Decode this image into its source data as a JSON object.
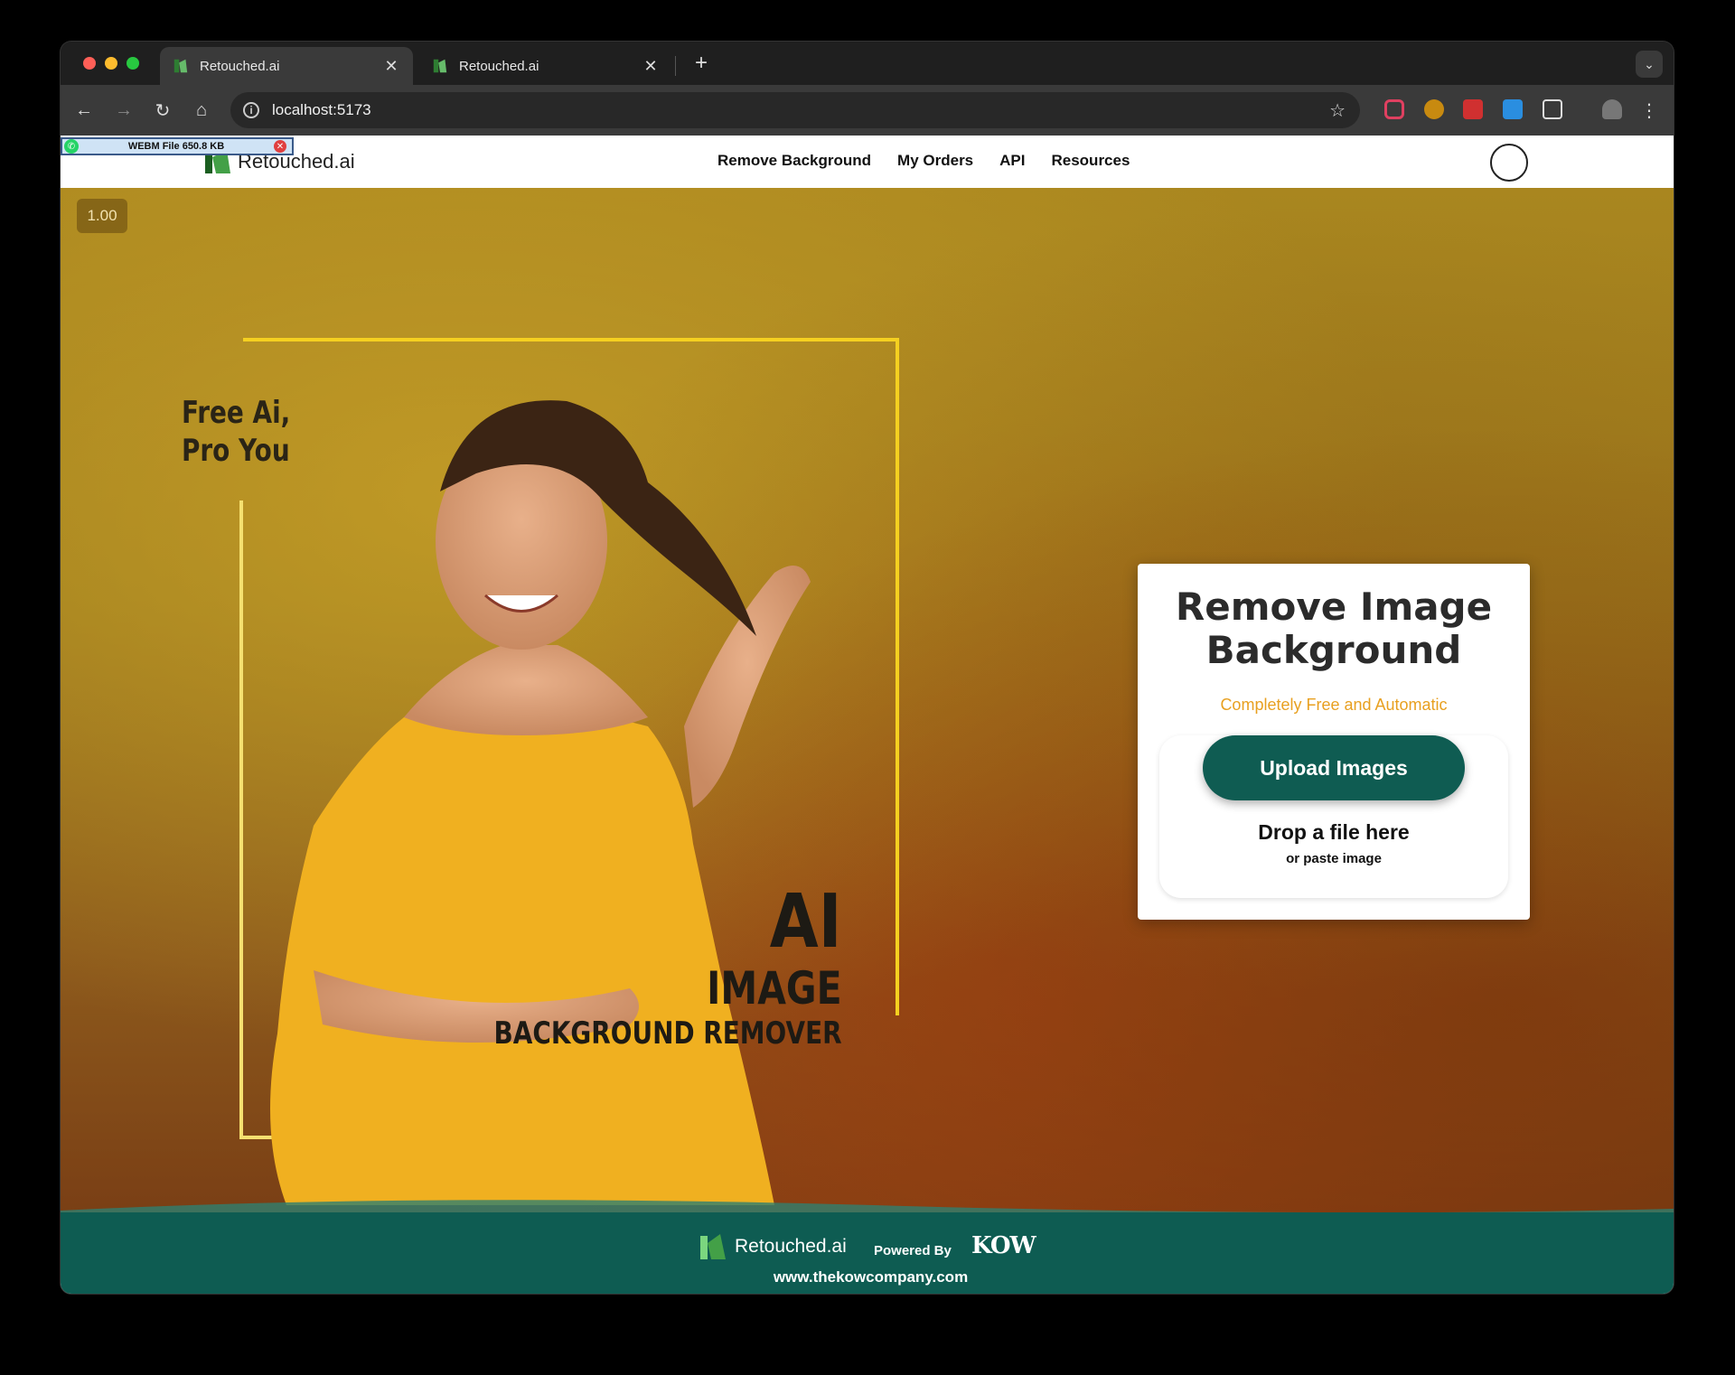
{
  "browser": {
    "tabs": [
      {
        "title": "Retouched.ai",
        "active": true
      },
      {
        "title": "Retouched.ai",
        "active": false
      }
    ],
    "url": "localhost:5173"
  },
  "download_badge": {
    "label": "WEBM File 650.8 KB"
  },
  "site": {
    "brand": "Retouched.ai",
    "nav": [
      "Remove Background",
      "My Orders",
      "API",
      "Resources"
    ]
  },
  "hero": {
    "zoom": "1.00",
    "slogan_line1": "Free Ai,",
    "slogan_line2": "Pro You",
    "banner_ai": "AI",
    "banner_image": "IMAGE",
    "banner_bg": "BACKGROUND REMOVER"
  },
  "card": {
    "title_line1": "Remove Image",
    "title_line2": "Background",
    "subtitle": "Completely Free and Automatic",
    "upload_label": "Upload Images",
    "drop_title": "Drop a file here",
    "drop_sub": "or paste image"
  },
  "footer": {
    "brand": "Retouched.ai",
    "powered_by": "Powered By",
    "partner": "KOW",
    "website": "www.thekowcompany.com"
  },
  "colors": {
    "accent_green": "#0f5c52",
    "subtitle_orange": "#e8a020",
    "frame_yellow": "#f5d020"
  }
}
